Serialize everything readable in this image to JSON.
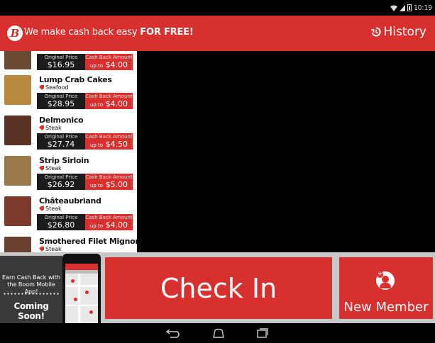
{
  "status_bar": {
    "time": "10:19"
  },
  "header": {
    "logo_letter": "B",
    "tagline_prefix": "We make cash back easy ",
    "tagline_emphasis": "FOR FREE!",
    "history_label": "History"
  },
  "menu": {
    "price_label": "Original Price",
    "cashback_label": "Cash Back Amount",
    "upto_label": "up to",
    "items": [
      {
        "name": "",
        "category": "",
        "price": "$16.95",
        "cashback": "$4.00",
        "thumb_color": "#6b4a33"
      },
      {
        "name": "Lump Crab Cakes",
        "category": "Seafood",
        "price": "$28.95",
        "cashback": "$4.00",
        "thumb_color": "#b98a3e"
      },
      {
        "name": "Delmonico",
        "category": "Steak",
        "price": "$27.74",
        "cashback": "$4.50",
        "thumb_color": "#5a3324"
      },
      {
        "name": "Strip Sirloin",
        "category": "Steak",
        "price": "$26.92",
        "cashback": "$5.00",
        "thumb_color": "#9a7a4a"
      },
      {
        "name": "Châteaubriand",
        "category": "Steak",
        "price": "$26.80",
        "cashback": "$4.00",
        "thumb_color": "#7a3a2c"
      },
      {
        "name": "Smothered Filet Mignon",
        "category": "Steak",
        "price": "",
        "cashback": "",
        "thumb_color": "#6a4030"
      }
    ]
  },
  "promo": {
    "line1": "Earn Cash Back with",
    "line2": "the Boom Mobile App!",
    "coming_soon": "Coming Soon!"
  },
  "actions": {
    "checkin_label": "Check In",
    "new_member_label": "New Member"
  },
  "colors": {
    "brand_red": "#d8302e",
    "panel_gray": "#c8c8c8"
  }
}
